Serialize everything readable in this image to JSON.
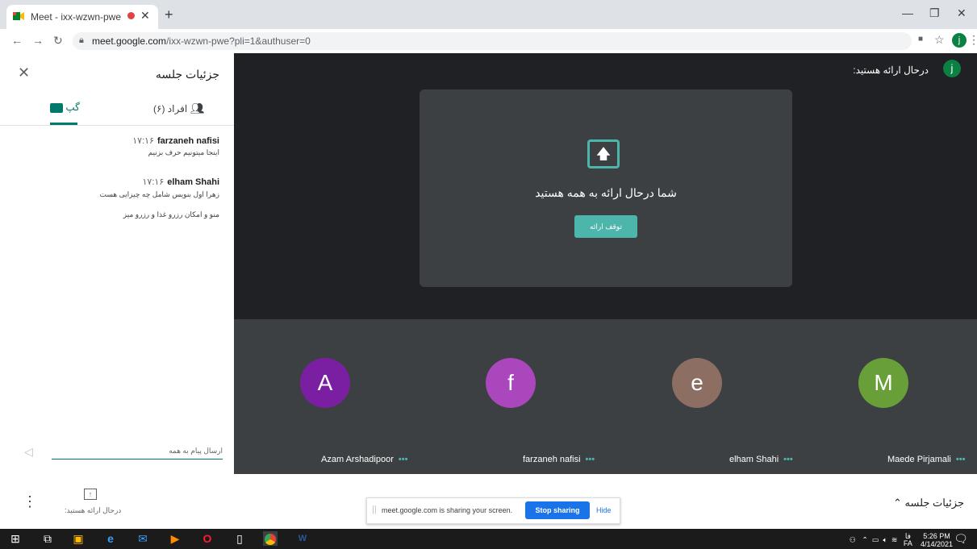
{
  "browser": {
    "tab_title": "Meet - ixx-wzwn-pwe",
    "url_host": "meet.google.com",
    "url_path": "/ixx-wzwn-pwe?pli=1&authuser=0",
    "profile_initial": "j"
  },
  "panel": {
    "title": "جزئیات جلسه",
    "tab_people": "افراد (۶)",
    "tab_chat": "گپ",
    "messages": [
      {
        "time": "۱۷:۱۶",
        "sender": "farzaneh nafisi",
        "lines": [
          "اینجا میتونیم حرف بزنیم"
        ]
      },
      {
        "time": "۱۷:۱۶",
        "sender": "elham Shahi",
        "lines": [
          "زهرا اول بنویس شامل چه چیزایی هست",
          "منو و امکان رزرو غذا و رزرو میز"
        ]
      }
    ],
    "input_placeholder": "ارسال پیام به همه"
  },
  "stage": {
    "presenting_label": "درحال ارائه هستید:",
    "presenter_initial": "j",
    "present_message": "شما درحال ارائه به همه هستید",
    "stop_button": "توقف ارائه"
  },
  "participants": [
    {
      "initial": "A",
      "name": "Azam Arshadipoor",
      "color": "#7b1fa2"
    },
    {
      "initial": "f",
      "name": "farzaneh nafisi",
      "color": "#ab47bc"
    },
    {
      "initial": "e",
      "name": "elham Shahi",
      "color": "#8d6e63"
    },
    {
      "initial": "M",
      "name": "Maede Pirjamali",
      "color": "#689f38"
    }
  ],
  "bottom": {
    "present_label": "درحال ارائه هستید:",
    "details_label": "جزئیات جلسه",
    "share_text": "meet.google.com is sharing your screen.",
    "stop_sharing": "Stop sharing",
    "hide": "Hide"
  },
  "taskbar": {
    "lang_top": "فا",
    "lang_bottom": "FA",
    "time": "5:26 PM",
    "date": "4/14/2021"
  }
}
